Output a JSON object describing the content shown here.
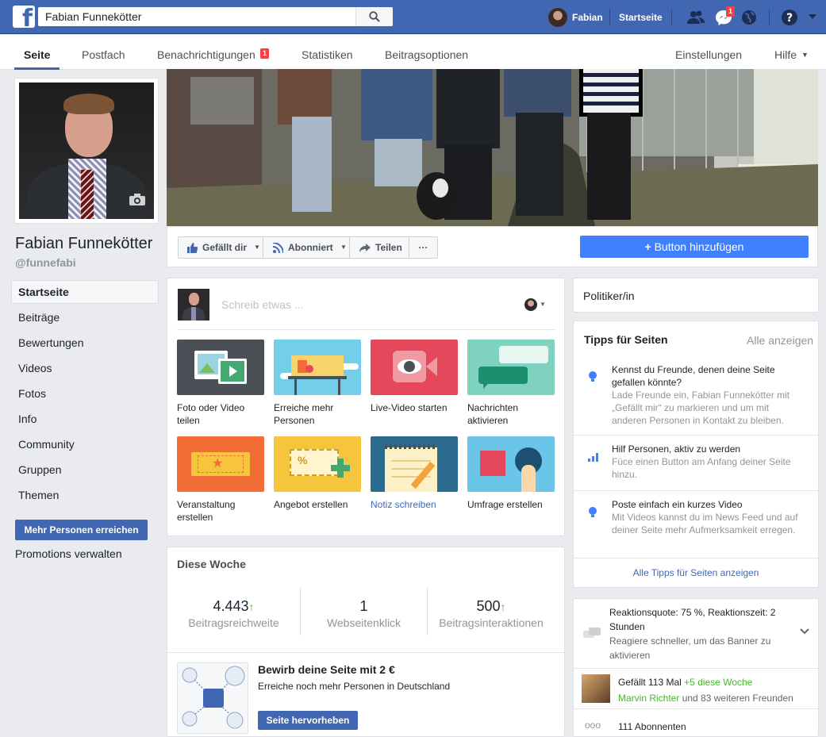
{
  "topbar": {
    "search_value": "Fabian Funnekötter",
    "user_name": "Fabian",
    "home_label": "Startseite",
    "messages_badge": "1",
    "brand_color": "#4267b2"
  },
  "page_nav": {
    "tabs": [
      "Seite",
      "Postfach",
      "Benachrichtigungen",
      "Statistiken",
      "Beitragsoptionen"
    ],
    "notifications_badge": "1",
    "settings_label": "Einstellungen",
    "help_label": "Hilfe"
  },
  "profile": {
    "name": "Fabian Funnekötter",
    "handle": "@funnefabi"
  },
  "left_nav": {
    "items": [
      "Startseite",
      "Beiträge",
      "Bewertungen",
      "Videos",
      "Fotos",
      "Info",
      "Community",
      "Gruppen",
      "Themen"
    ],
    "reach_button": "Mehr Personen erreichen",
    "promotions_link": "Promotions verwalten"
  },
  "actions": {
    "like": "Gefällt dir",
    "follow": "Abonniert",
    "share": "Teilen",
    "more": "···",
    "add_button": "Button hinzufügen"
  },
  "composer": {
    "placeholder": "Schreib etwas ...",
    "tiles": [
      {
        "label": "Foto oder Video teilen",
        "color": "#4b4f56"
      },
      {
        "label": "Erreiche mehr Personen",
        "color": "#73cfe9"
      },
      {
        "label": "Live-Video starten",
        "color": "#e5475b"
      },
      {
        "label": "Nachrichten aktivieren",
        "color": "#7fd2c0"
      },
      {
        "label": "Veranstaltung erstellen",
        "color": "#f26c35"
      },
      {
        "label": "Angebot erstellen",
        "color": "#f7c43e"
      },
      {
        "label": "Notiz schreiben",
        "color": "#2a6b8f"
      },
      {
        "label": "Umfrage erstellen",
        "color": "#6bc5e8"
      }
    ]
  },
  "this_week": {
    "title": "Diese Woche",
    "stats": [
      {
        "value": "4.443",
        "label": "Beitragsreichweite",
        "trend": "up"
      },
      {
        "value": "1",
        "label": "Webseitenklick",
        "trend": ""
      },
      {
        "value": "500",
        "label": "Beitragsinteraktionen",
        "trend": "up"
      }
    ],
    "promo_title": "Bewirb deine Seite mit 2 €",
    "promo_text": "Erreiche noch mehr Personen in Deutschland",
    "promo_button": "Seite hervorheben"
  },
  "right": {
    "category": "Politiker/in",
    "tips_title": "Tipps für Seiten",
    "tips_see_all": "Alle anzeigen",
    "tips": [
      {
        "title": "Kennst du Freunde, denen deine Seite gefallen könnte?",
        "text": "Lade Freunde ein, Fabian Funnekötter mit „Gefällt mir“ zu markieren und um mit anderen Personen in Kontakt zu bleiben."
      },
      {
        "title": "Hilf Personen, aktiv zu werden",
        "text": "Füce einen Button am Anfang deiner Seite hinzu."
      },
      {
        "title": "Poste einfach ein kurzes Video",
        "text": "Mit Videos kannst du im News Feed und auf deiner Seite mehr Aufmerksamkeit erregen."
      }
    ],
    "tips_footer": "Alle Tipps für Seiten anzeigen",
    "response": {
      "title": "Reaktionsquote: 75 %, Reaktionszeit: 2 Stunden",
      "text": "Reagiere schneller, um das Banner zu aktivieren"
    },
    "likes": {
      "prefix": "Gefällt 113 Mal",
      "weekly": "+5 diese Woche",
      "friend": "Marvin Richter",
      "friends_suffix": "und 83 weiteren Freunden"
    },
    "followers": "111 Abonnenten"
  }
}
